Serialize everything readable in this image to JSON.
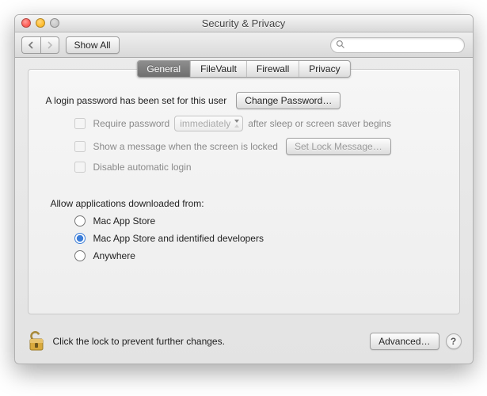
{
  "window": {
    "title": "Security & Privacy"
  },
  "toolbar": {
    "show_all": "Show All",
    "search_placeholder": ""
  },
  "tabs": [
    "General",
    "FileVault",
    "Firewall",
    "Privacy"
  ],
  "active_tab_index": 0,
  "general": {
    "login_password_text": "A login password has been set for this user",
    "change_password_btn": "Change Password…",
    "require_password_label": "Require password",
    "require_password_after": "after sleep or screen saver begins",
    "require_password_options": [
      "immediately"
    ],
    "require_password_selected": "immediately",
    "show_message_label": "Show a message when the screen is locked",
    "set_lock_message_btn": "Set Lock Message…",
    "disable_auto_login_label": "Disable automatic login",
    "allow_apps_label": "Allow applications downloaded from:",
    "allow_apps_options": [
      "Mac App Store",
      "Mac App Store and identified developers",
      "Anywhere"
    ],
    "allow_apps_selected_index": 1
  },
  "footer": {
    "lock_text": "Click the lock to prevent further changes.",
    "advanced_btn": "Advanced…"
  }
}
